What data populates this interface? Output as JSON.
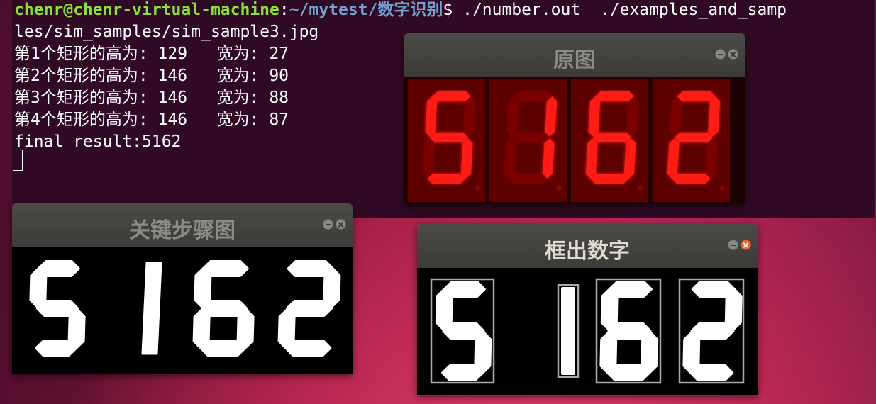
{
  "terminal": {
    "prompt_user": "chenr@chenr-virtual-machine",
    "prompt_sep": ":",
    "prompt_path": "~/mytest/数字识别",
    "prompt_end": "$ ",
    "command_line1": "./number.out  ./examples_and_samp",
    "command_line2": "les/sim_samples/sim_sample3.jpg",
    "output": [
      "第1个矩形的高为: 129   宽为: 27",
      "第2个矩形的高为: 146   宽为: 90",
      "第3个矩形的高为: 146   宽为: 88",
      "第4个矩形的高为: 146   宽为: 87"
    ],
    "result": "final result:5162"
  },
  "windows": {
    "original": {
      "title": "原图"
    },
    "key_steps": {
      "title": "关键步骤图"
    },
    "boxed_digits": {
      "title": "框出数字"
    }
  },
  "digits": [
    "5",
    "1",
    "6",
    "2"
  ],
  "colors": {
    "terminal_bg": "#300a24",
    "prompt_user": "#8ae234",
    "prompt_path": "#729fcf",
    "segment_on": "#ff1a12",
    "segment_off": "#7a0606",
    "display_bg": "#5c0000",
    "close_button_active": "#e9653b"
  },
  "icons": {
    "minimize": "minimize-icon",
    "close": "close-icon"
  }
}
